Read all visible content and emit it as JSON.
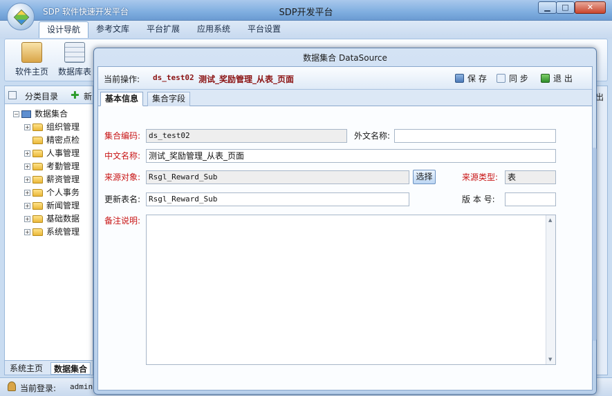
{
  "window": {
    "title": "SDP开发平台",
    "subtitle": "SDP 软件快速开发平台",
    "minimize_glyph": "▁",
    "maximize_glyph": "□",
    "close_glyph": "✕"
  },
  "menu": {
    "tabs": [
      {
        "label": "设计导航",
        "active": true
      },
      {
        "label": "参考文库"
      },
      {
        "label": "平台扩展"
      },
      {
        "label": "应用系统"
      },
      {
        "label": "平台设置"
      }
    ]
  },
  "ribbon": {
    "items": [
      {
        "label": "软件主页",
        "icon": "home-icon"
      },
      {
        "label": "数据库表",
        "icon": "table-icon"
      }
    ]
  },
  "sidebar": {
    "header_label": "分类目录",
    "add_label": "新",
    "tree": {
      "root": "数据集合",
      "children": [
        {
          "label": "组织管理",
          "expandable": true
        },
        {
          "label": "精密点检",
          "expandable": false
        },
        {
          "label": "人事管理",
          "expandable": true
        },
        {
          "label": "考勤管理",
          "expandable": true
        },
        {
          "label": "薪资管理",
          "expandable": true
        },
        {
          "label": "个人事务",
          "expandable": true
        },
        {
          "label": "新闻管理",
          "expandable": true
        },
        {
          "label": "基础数据",
          "expandable": true
        },
        {
          "label": "系统管理",
          "expandable": true
        }
      ]
    },
    "bottom_tabs": [
      "系统主页",
      "数据集合"
    ]
  },
  "statusbar": {
    "login_label": "当前登录:",
    "user": "admin"
  },
  "rightpane": {
    "label": "出"
  },
  "dialog": {
    "title": "数据集合  DataSource",
    "current_op_label": "当前操作:",
    "current_op_code": "ds_test02",
    "current_op_name": "测试_奖励管理_从表_页面",
    "save_label": "保 存",
    "sync_label": "同 步",
    "exit_label": "退 出",
    "tabs": [
      "基本信息",
      "集合字段"
    ],
    "form": {
      "code_label": "集合编码:",
      "code_value": "ds_test02",
      "foreign_label": "外文名称:",
      "foreign_value": "",
      "cn_label": "中文名称:",
      "cn_value": "测试_奖励管理_从表_页面",
      "source_label": "来源对象:",
      "source_value": "Rsgl_Reward_Sub",
      "select_label": "选择",
      "source_type_label": "来源类型:",
      "source_type_value": "表",
      "update_label": "更新表名:",
      "update_value": "Rsgl_Reward_Sub",
      "version_label": "版 本 号:",
      "version_value": "",
      "remark_label": "备注说明:",
      "remark_value": ""
    }
  },
  "colors": {
    "required_label": "#c81414",
    "op_text": "#8b1313",
    "title_bar": "#7faee0"
  }
}
